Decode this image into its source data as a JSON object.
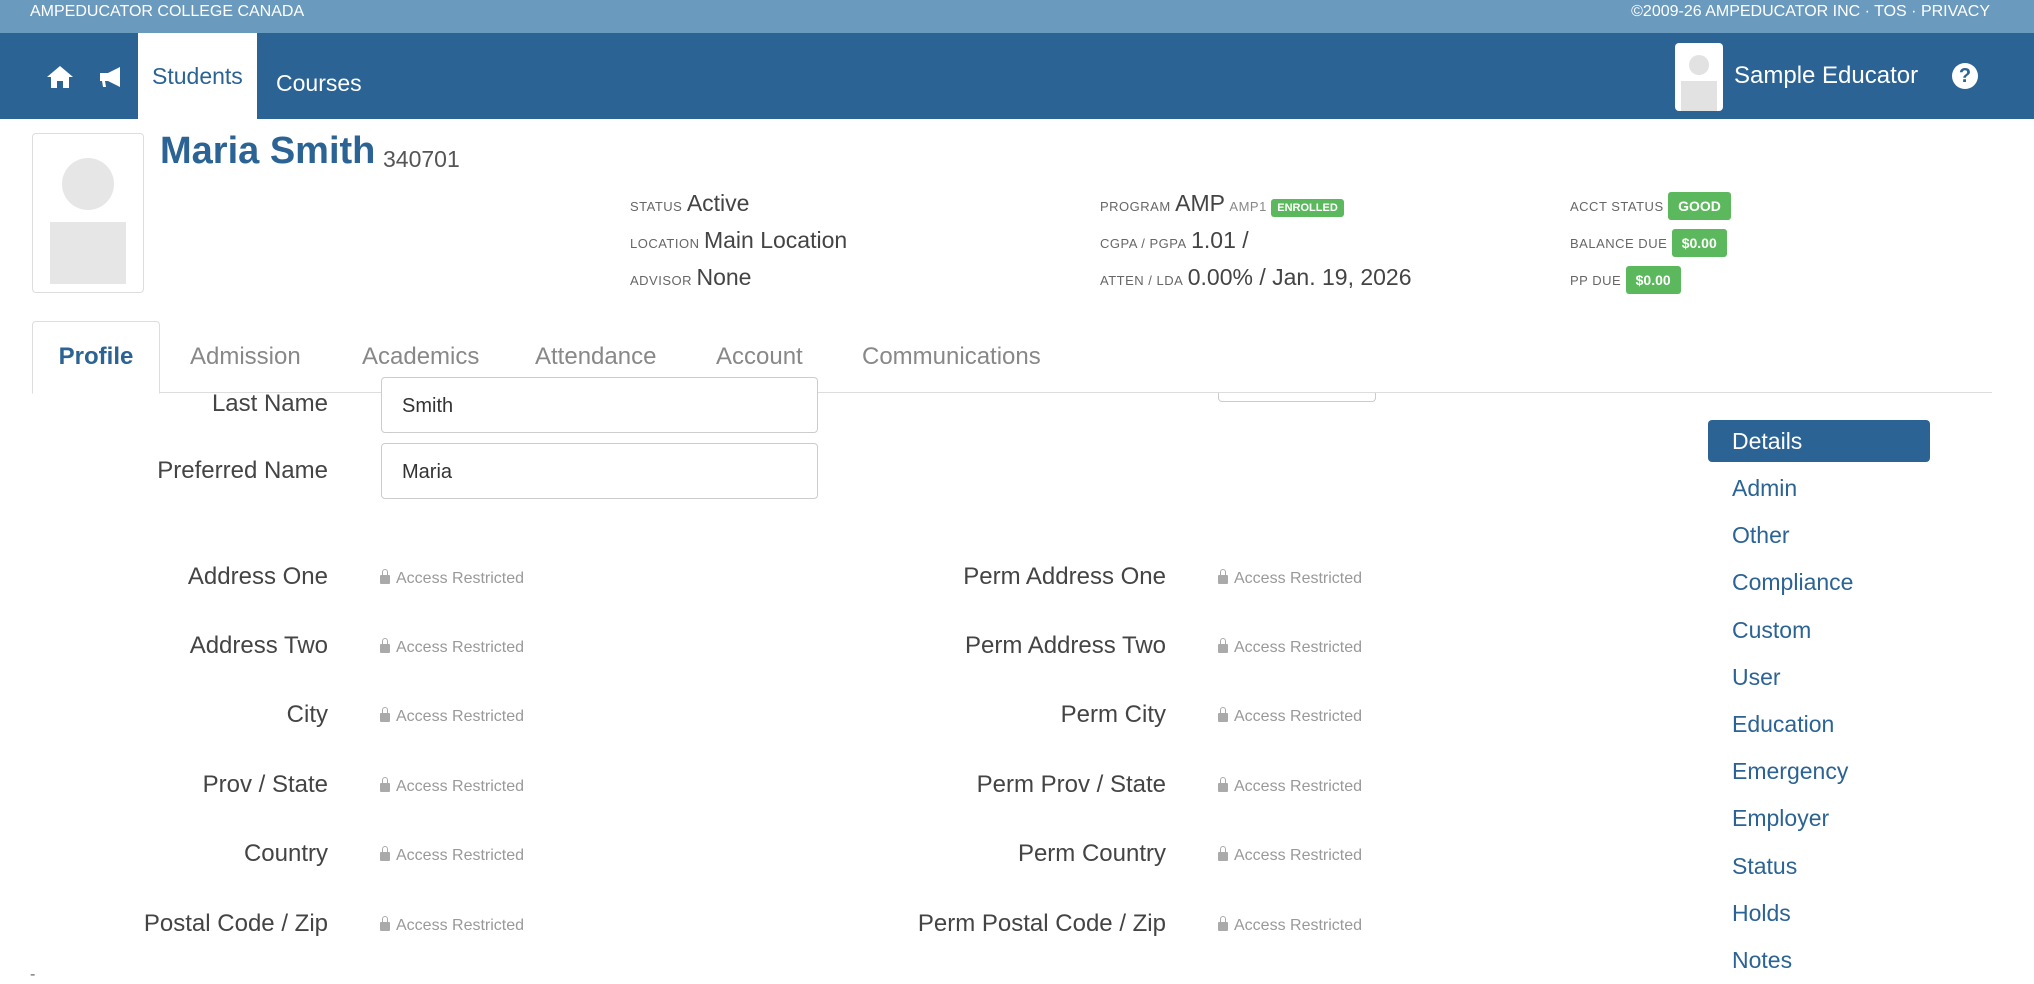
{
  "topbar": {
    "college_name": "AMPEDUCATOR COLLEGE CANADA",
    "copyright": "©2009-26 AMPEDUCATOR INC · TOS · PRIVACY"
  },
  "nav": {
    "home_icon": "home-icon",
    "announce_icon": "megaphone-icon",
    "tabs": [
      {
        "label": "Students",
        "active": true
      },
      {
        "label": "Courses",
        "active": false
      }
    ],
    "user_name": "Sample Educator",
    "help_icon": "question-icon",
    "help_glyph": "?"
  },
  "student": {
    "name": "Maria Smith",
    "id": "340701",
    "status_label": "STATUS",
    "status": "Active",
    "location_label": "LOCATION",
    "location": "Main Location",
    "advisor_label": "ADVISOR",
    "advisor": "None",
    "program_label": "PROGRAM",
    "program": "AMP",
    "program_code": "AMP1",
    "program_badge": "ENROLLED",
    "cgpa_label": "CGPA / PGPA",
    "cgpa": "1.01 /",
    "atten_label": "ATTEN / LDA",
    "atten": "0.00% / Jan. 19, 2026",
    "acct_status_label": "ACCT STATUS",
    "acct_status": "GOOD",
    "balance_label": "BALANCE DUE",
    "balance": "$0.00",
    "pp_label": "PP DUE",
    "pp": "$0.00"
  },
  "tabs": [
    "Profile",
    "Admission",
    "Academics",
    "Attendance",
    "Account",
    "Communications"
  ],
  "form": {
    "last_name_label": "Last Name",
    "last_name": "Smith",
    "preferred_name_label": "Preferred Name",
    "preferred_name": "Maria",
    "restricted_text": "Access Restricted",
    "left_fields": [
      "Address One",
      "Address Two",
      "City",
      "Prov / State",
      "Country",
      "Postal Code / Zip"
    ],
    "right_fields": [
      "Perm Address One",
      "Perm Address Two",
      "Perm City",
      "Perm Prov / State",
      "Perm Country",
      "Perm Postal Code / Zip"
    ]
  },
  "sidenav": [
    "Details",
    "Admin",
    "Other",
    "Compliance",
    "Custom",
    "User",
    "Education",
    "Emergency",
    "Employer",
    "Status",
    "Holds",
    "Notes"
  ],
  "footer_mark": "-",
  "colors": {
    "brand": "#2b6394",
    "topstrip": "#6a9bbf",
    "badge_green": "#5cb85c"
  }
}
